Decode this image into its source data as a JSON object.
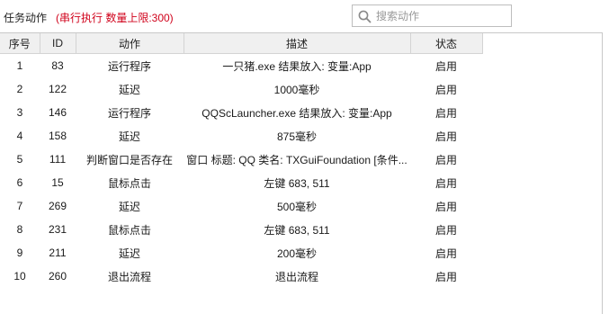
{
  "header": {
    "title": "任务动作",
    "subtitle": "(串行执行 数量上限:300)",
    "search_placeholder": "搜索动作"
  },
  "table": {
    "columns": [
      "序号",
      "ID",
      "动作",
      "描述",
      "状态"
    ],
    "rows": [
      {
        "no": "1",
        "id": "83",
        "action": "运行程序",
        "desc": "一只猪.exe  结果放入: 变量:App",
        "status": "启用"
      },
      {
        "no": "2",
        "id": "122",
        "action": "延迟",
        "desc": "1000毫秒",
        "status": "启用"
      },
      {
        "no": "3",
        "id": "146",
        "action": "运行程序",
        "desc": "QQScLauncher.exe  结果放入: 变量:App",
        "status": "启用"
      },
      {
        "no": "4",
        "id": "158",
        "action": "延迟",
        "desc": "875毫秒",
        "status": "启用"
      },
      {
        "no": "5",
        "id": "111",
        "action": "判断窗口是否存在",
        "desc": "窗口 标题: QQ 类名: TXGuiFoundation [条件...",
        "status": "启用"
      },
      {
        "no": "6",
        "id": "15",
        "action": "鼠标点击",
        "desc": "左键 683, 511",
        "status": "启用"
      },
      {
        "no": "7",
        "id": "269",
        "action": "延迟",
        "desc": "500毫秒",
        "status": "启用"
      },
      {
        "no": "8",
        "id": "231",
        "action": "鼠标点击",
        "desc": "左键 683, 511",
        "status": "启用"
      },
      {
        "no": "9",
        "id": "211",
        "action": "延迟",
        "desc": "200毫秒",
        "status": "启用"
      },
      {
        "no": "10",
        "id": "260",
        "action": "退出流程",
        "desc": "退出流程",
        "status": "启用"
      }
    ]
  }
}
